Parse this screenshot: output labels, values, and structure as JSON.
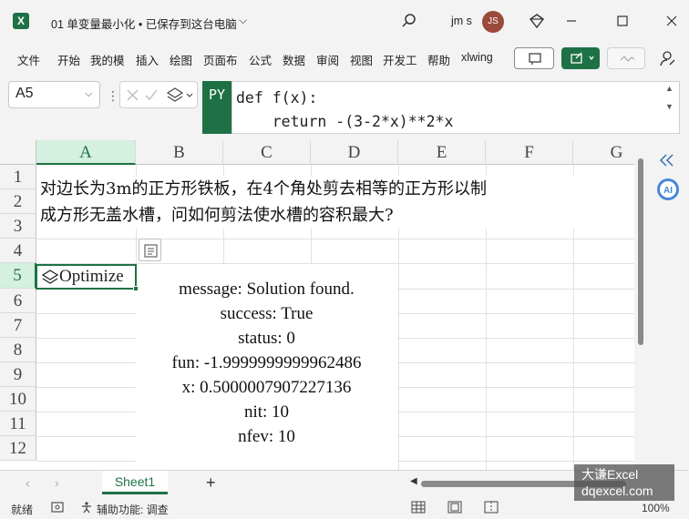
{
  "window": {
    "doc_title": "01 单变量最小化 • 已保存到这台电脑",
    "user_name": "jm s",
    "avatar_initials": "JS"
  },
  "ribbon": {
    "tabs": [
      "文件",
      "开始",
      "我的模",
      "插入",
      "绘图",
      "页面布",
      "公式",
      "数据",
      "审阅",
      "视图",
      "开发工",
      "帮助",
      "xlwing"
    ]
  },
  "formula_bar": {
    "name_box": "A5",
    "py_badge": "PY",
    "formula_line1": "def f(x):",
    "formula_line2": "    return -(3-2*x)**2*x"
  },
  "grid": {
    "columns": [
      "A",
      "B",
      "C",
      "D",
      "E",
      "F",
      "G"
    ],
    "rows": [
      "1",
      "2",
      "3",
      "4",
      "5",
      "6",
      "7",
      "8",
      "9",
      "10",
      "11",
      "12"
    ],
    "problem_line1": "对边长为3m的正方形铁板，在4个角处剪去相等的正方形以制",
    "problem_line2": "成方形无盖水槽，问如何剪法使水槽的容积最大?",
    "active_cell_text": "Optimize",
    "result_lines": [
      "message: Solution found.",
      "success: True",
      "status: 0",
      "fun: -1.9999999999962486",
      "x: 0.5000007907227136",
      "nit: 10",
      "nfev: 10"
    ]
  },
  "sheets": {
    "active_sheet": "Sheet1",
    "add_label": "+"
  },
  "status": {
    "ready": "就绪",
    "accessibility": "辅助功能: 调查",
    "zoom": "100%"
  },
  "watermark": {
    "line1": "大谦Excel",
    "line2": "dqexcel.com"
  },
  "colors": {
    "accent": "#1e7145"
  }
}
